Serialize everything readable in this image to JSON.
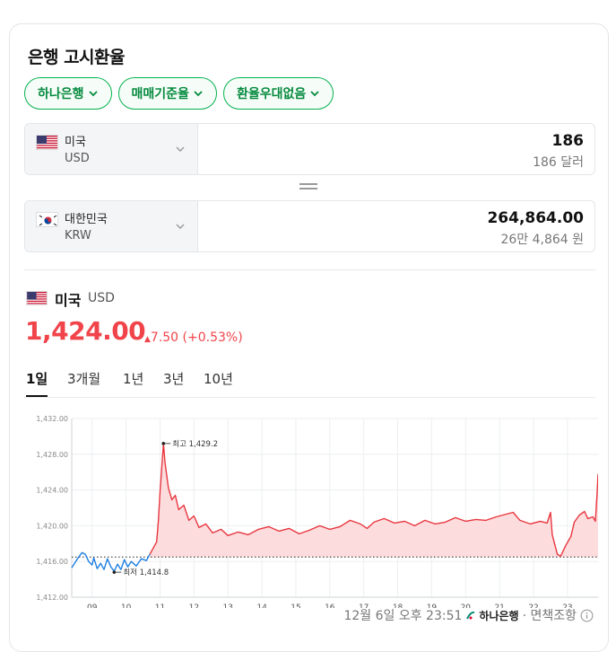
{
  "widget": {
    "title": "은행 고시환율"
  },
  "filters": [
    {
      "label": "하나은행"
    },
    {
      "label": "매매기준율"
    },
    {
      "label": "환율우대없음"
    }
  ],
  "converter": {
    "from": {
      "country": "미국",
      "code": "USD",
      "amount": "186",
      "amount_text": "186 달러"
    },
    "to": {
      "country": "대한민국",
      "code": "KRW",
      "amount": "264,864.00",
      "amount_text": "26만 4,864 원"
    }
  },
  "summary": {
    "country": "미국",
    "code": "USD",
    "price": "1,424.00",
    "change": "7.50 (+0.53%)"
  },
  "tabs": [
    {
      "label": "1일",
      "active": true
    },
    {
      "label": "3개월",
      "active": false
    },
    {
      "label": "1년",
      "active": false
    },
    {
      "label": "3년",
      "active": false
    },
    {
      "label": "10년",
      "active": false
    }
  ],
  "chart_data": {
    "type": "line",
    "ylim": [
      1412,
      1432
    ],
    "y_ticks": [
      "1,412.00",
      "1,416.00",
      "1,420.00",
      "1,424.00",
      "1,428.00",
      "1,432.00"
    ],
    "y_tick_values": [
      1412,
      1416,
      1420,
      1424,
      1428,
      1432
    ],
    "x_ticks": [
      "09",
      "10",
      "11",
      "12",
      "13",
      "14",
      "15",
      "16",
      "17",
      "18",
      "19",
      "20",
      "21",
      "22",
      "23"
    ],
    "xlim": [
      8.4,
      23.9
    ],
    "baseline": 1416.5,
    "colors": {
      "up": "#e8373f",
      "down": "#1f7fe0",
      "fill": "#fcdcdd",
      "baseline": "#222222"
    },
    "series_down": [
      [
        8.4,
        1415.3
      ],
      [
        8.55,
        1416.2
      ],
      [
        8.7,
        1417.0
      ],
      [
        8.8,
        1416.8
      ],
      [
        8.9,
        1416.0
      ],
      [
        9.0,
        1415.6
      ],
      [
        9.05,
        1416.4
      ],
      [
        9.15,
        1415.2
      ],
      [
        9.25,
        1415.8
      ],
      [
        9.35,
        1415.1
      ],
      [
        9.45,
        1416.3
      ],
      [
        9.55,
        1415.4
      ],
      [
        9.65,
        1414.9
      ],
      [
        9.75,
        1415.7
      ],
      [
        9.85,
        1415.1
      ],
      [
        9.95,
        1416.2
      ],
      [
        10.05,
        1415.4
      ],
      [
        10.15,
        1416.0
      ],
      [
        10.3,
        1415.5
      ],
      [
        10.45,
        1416.3
      ],
      [
        10.6,
        1416.1
      ],
      [
        10.7,
        1416.8
      ]
    ],
    "series_up": [
      [
        10.7,
        1416.8
      ],
      [
        10.8,
        1417.5
      ],
      [
        10.9,
        1418.2
      ],
      [
        10.95,
        1420.5
      ],
      [
        11.0,
        1423.8
      ],
      [
        11.05,
        1426.5
      ],
      [
        11.1,
        1429.2
      ],
      [
        11.15,
        1427.0
      ],
      [
        11.25,
        1424.2
      ],
      [
        11.35,
        1422.9
      ],
      [
        11.45,
        1423.4
      ],
      [
        11.55,
        1421.8
      ],
      [
        11.7,
        1422.3
      ],
      [
        11.85,
        1420.6
      ],
      [
        12.0,
        1421.1
      ],
      [
        12.15,
        1419.8
      ],
      [
        12.35,
        1420.2
      ],
      [
        12.55,
        1419.2
      ],
      [
        12.8,
        1419.6
      ],
      [
        13.0,
        1418.9
      ],
      [
        13.3,
        1419.3
      ],
      [
        13.6,
        1419.0
      ],
      [
        13.9,
        1419.6
      ],
      [
        14.2,
        1419.9
      ],
      [
        14.5,
        1419.4
      ],
      [
        14.8,
        1419.7
      ],
      [
        15.1,
        1419.1
      ],
      [
        15.4,
        1419.5
      ],
      [
        15.7,
        1420.0
      ],
      [
        16.0,
        1419.6
      ],
      [
        16.3,
        1419.9
      ],
      [
        16.6,
        1420.6
      ],
      [
        16.9,
        1420.2
      ],
      [
        17.1,
        1419.7
      ],
      [
        17.3,
        1420.4
      ],
      [
        17.6,
        1420.8
      ],
      [
        17.9,
        1420.3
      ],
      [
        18.2,
        1420.5
      ],
      [
        18.5,
        1420.0
      ],
      [
        18.8,
        1420.6
      ],
      [
        19.1,
        1420.2
      ],
      [
        19.4,
        1420.4
      ],
      [
        19.7,
        1420.9
      ],
      [
        20.0,
        1420.5
      ],
      [
        20.3,
        1420.7
      ],
      [
        20.6,
        1420.6
      ],
      [
        20.9,
        1421.0
      ],
      [
        21.2,
        1421.3
      ],
      [
        21.4,
        1421.5
      ],
      [
        21.6,
        1420.6
      ],
      [
        21.9,
        1420.2
      ],
      [
        22.2,
        1420.5
      ],
      [
        22.4,
        1420.3
      ],
      [
        22.5,
        1421.5
      ],
      [
        22.55,
        1419.0
      ],
      [
        22.7,
        1416.8
      ],
      [
        22.8,
        1416.6
      ],
      [
        22.95,
        1417.8
      ],
      [
        23.1,
        1418.8
      ],
      [
        23.2,
        1420.4
      ],
      [
        23.35,
        1421.2
      ],
      [
        23.5,
        1421.6
      ],
      [
        23.6,
        1420.8
      ],
      [
        23.75,
        1421.0
      ],
      [
        23.82,
        1420.5
      ],
      [
        23.87,
        1423.6
      ],
      [
        23.9,
        1425.8
      ]
    ],
    "high": {
      "x": 11.1,
      "y": 1429.2,
      "label": "최고 1,429.2"
    },
    "low": {
      "x": 9.65,
      "y": 1414.8,
      "label": "최저 1,414.8"
    }
  },
  "footer": {
    "timestamp": "12월 6일 오후 23:51",
    "source": "하나은행",
    "disclaimer": "· 면책조항"
  }
}
